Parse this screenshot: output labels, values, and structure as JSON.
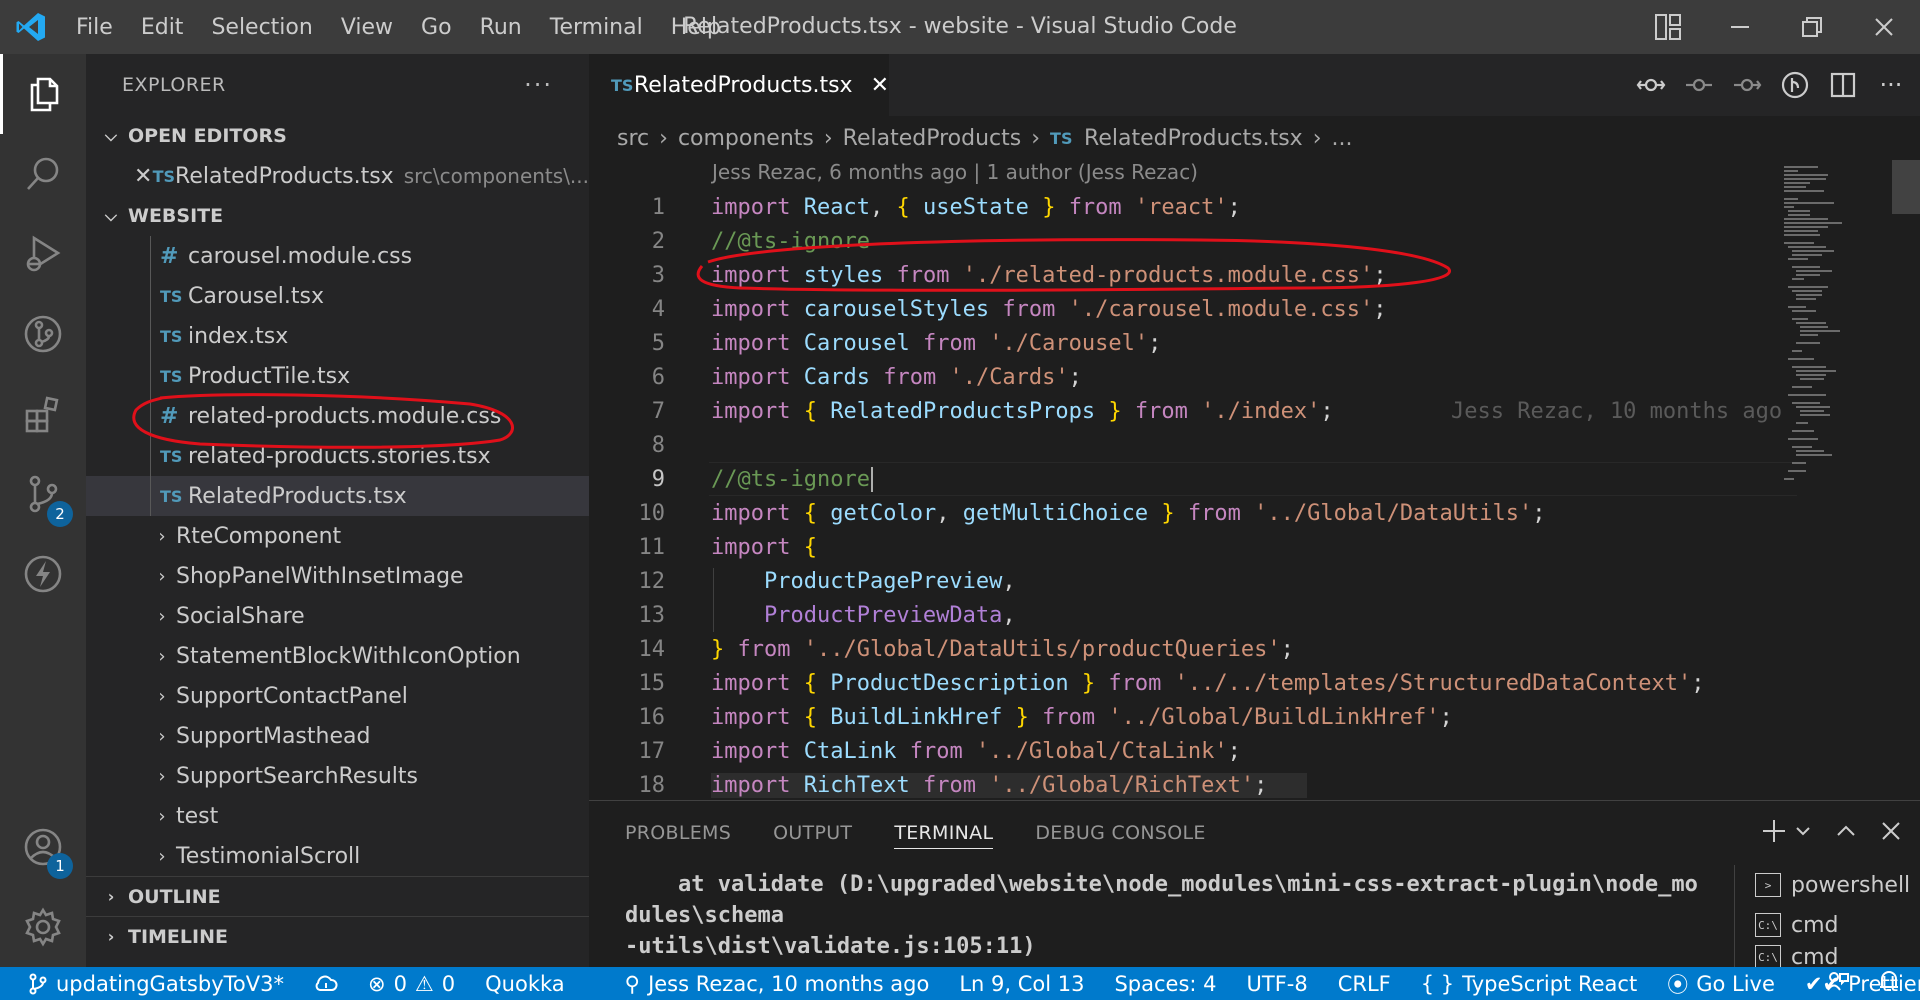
{
  "titlebar": {
    "menu": [
      "File",
      "Edit",
      "Selection",
      "View",
      "Go",
      "Run",
      "Terminal",
      "Help"
    ],
    "title": "RelatedProducts.tsx - website - Visual Studio Code"
  },
  "activity": {
    "scm_badge": "2",
    "account_badge": "1"
  },
  "sidebar": {
    "header": "EXPLORER",
    "open_editors": {
      "label": "OPEN EDITORS",
      "items": [
        {
          "icon": "TS",
          "name": "RelatedProducts.tsx",
          "path": "src\\components\\..."
        }
      ]
    },
    "workspace": {
      "label": "WEBSITE",
      "files": [
        {
          "icon": "#",
          "name": "carousel.module.css"
        },
        {
          "icon": "TS",
          "name": "Carousel.tsx"
        },
        {
          "icon": "TS",
          "name": "index.tsx"
        },
        {
          "icon": "TS",
          "name": "ProductTile.tsx"
        },
        {
          "icon": "#",
          "name": "related-products.module.css"
        },
        {
          "icon": "TS",
          "name": "related-products.stories.tsx"
        },
        {
          "icon": "TS",
          "name": "RelatedProducts.tsx"
        }
      ],
      "folders": [
        "RteComponent",
        "ShopPanelWithInsetImage",
        "SocialShare",
        "StatementBlockWithIconOption",
        "SupportContactPanel",
        "SupportMasthead",
        "SupportSearchResults",
        "test",
        "TestimonialScroll"
      ]
    },
    "outline_label": "OUTLINE",
    "timeline_label": "TIMELINE"
  },
  "editor": {
    "tab": {
      "icon": "TS",
      "name": "RelatedProducts.tsx"
    },
    "breadcrumb": {
      "parts": [
        "src",
        "components",
        "RelatedProducts"
      ],
      "file_icon": "TS",
      "file": "RelatedProducts.tsx",
      "more": "..."
    },
    "blame_header": "Jess Rezac, 6 months ago | 1 author (Jess Rezac)",
    "inline_blame": "Jess Rezac, 10 months ago",
    "line_numbers": [
      "1",
      "2",
      "3",
      "4",
      "5",
      "6",
      "7",
      "8",
      "9",
      "10",
      "11",
      "12",
      "13",
      "14",
      "15",
      "16",
      "17",
      "18"
    ],
    "current_line": 9
  },
  "panel": {
    "tabs": [
      "PROBLEMS",
      "OUTPUT",
      "TERMINAL",
      "DEBUG CONSOLE"
    ],
    "active_tab": "TERMINAL",
    "terminal_lines": [
      "    at validate (D:\\upgraded\\website\\node_modules\\mini-css-extract-plugin\\node_mo",
      "dules\\schema",
      "-utils\\dist\\validate.js:105:11)"
    ],
    "terminals": [
      {
        "icon": ">",
        "name": "powershell"
      },
      {
        "icon": "C:\\",
        "name": "cmd"
      },
      {
        "icon": "C:\\",
        "name": "cmd"
      }
    ]
  },
  "statusbar": {
    "branch": "updatingGatsbyToV3*",
    "errors": "0",
    "warnings": "0",
    "quokka": "Quokka",
    "blame": "Jess Rezac, 10 months ago",
    "position": "Ln 9, Col 13",
    "spaces": "Spaces: 4",
    "encoding": "UTF-8",
    "eol": "CRLF",
    "language": "TypeScript React",
    "golive": "Go Live",
    "prettier": "Prettier"
  },
  "colors": {
    "accent": "#007acc",
    "annotation": "#e0101a"
  }
}
